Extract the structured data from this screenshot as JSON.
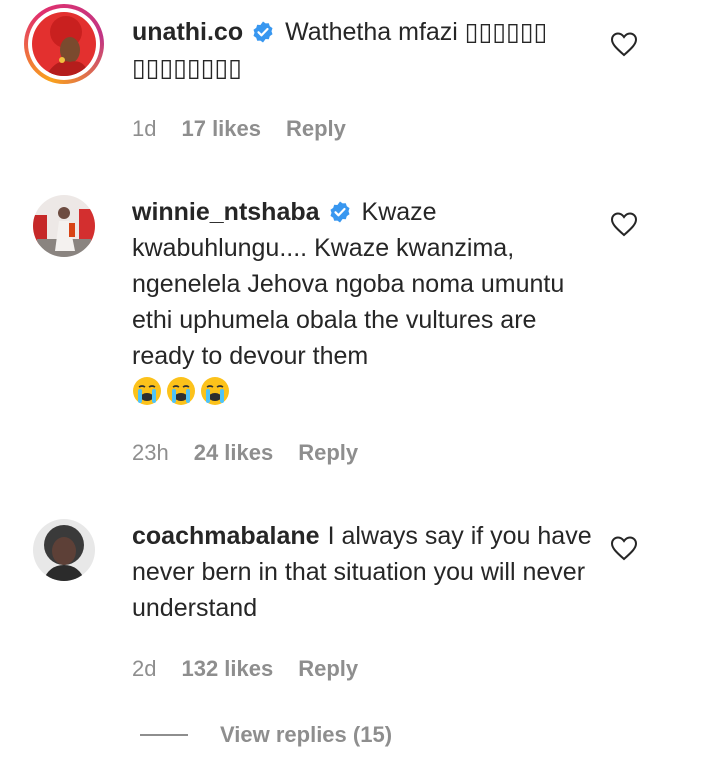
{
  "colors": {
    "text": "#262626",
    "secondary": "#8e8e8e",
    "verified": "#3897f0",
    "story_ring": "#e1306c"
  },
  "comments": [
    {
      "username": "unathi.co",
      "verified": true,
      "text": "Wathetha mfazi ▯▯▯▯▯▯ ▯▯▯▯▯▯▯▯",
      "emojis": [],
      "time": "1d",
      "likes": "17 likes",
      "reply": "Reply",
      "icons": [
        "verified-badge-icon",
        "heart-outline-icon"
      ]
    },
    {
      "username": "winnie_ntshaba",
      "verified": true,
      "text": "Kwaze kwabuhlungu.... Kwaze kwanzima, ngenelela Jehova ngoba noma umuntu ethi uphumela obala the vultures are ready to devour them",
      "emojis": [
        "crying-face-emoji",
        "crying-face-emoji",
        "crying-face-emoji"
      ],
      "time": "23h",
      "likes": "24 likes",
      "reply": "Reply",
      "icons": [
        "verified-badge-icon",
        "heart-outline-icon"
      ]
    },
    {
      "username": "coachmabalane",
      "verified": false,
      "text": "I always say if you have never bern in that situation you will never understand",
      "emojis": [],
      "time": "2d",
      "likes": "132 likes",
      "reply": "Reply",
      "icons": [
        "heart-outline-icon"
      ]
    }
  ],
  "view_replies": "View replies (15)"
}
